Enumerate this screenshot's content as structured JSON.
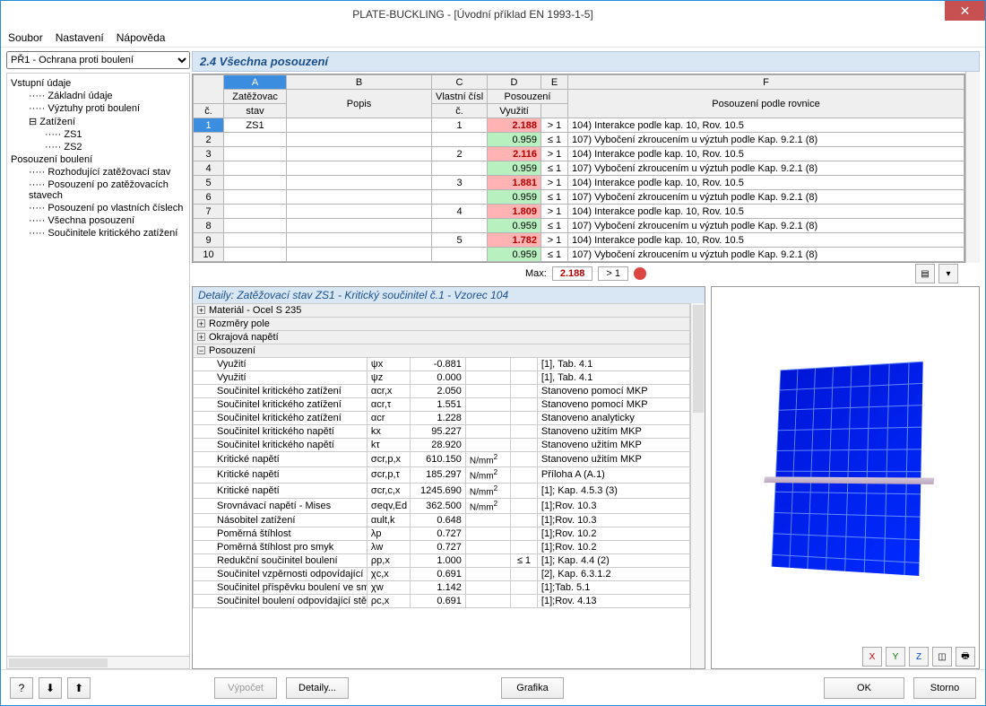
{
  "title": "PLATE-BUCKLING - [Úvodní příklad EN 1993-1-5]",
  "menu": {
    "soubor": "Soubor",
    "nastaveni": "Nastavení",
    "napoveda": "Nápověda"
  },
  "selector": "PŘ1 - Ochrana proti boulení",
  "tree": [
    {
      "lvl": 0,
      "t": "Vstupní údaje"
    },
    {
      "lvl": 1,
      "t": "Základní údaje"
    },
    {
      "lvl": 1,
      "t": "Výztuhy proti boulení"
    },
    {
      "lvl": 1,
      "t": "Zatížení",
      "exp": true
    },
    {
      "lvl": 2,
      "t": "ZS1"
    },
    {
      "lvl": 2,
      "t": "ZS2"
    },
    {
      "lvl": 0,
      "t": "Posouzení boulení"
    },
    {
      "lvl": 1,
      "t": "Rozhodující zatěžovací stav"
    },
    {
      "lvl": 1,
      "t": "Posouzení po zatěžovacích stavech"
    },
    {
      "lvl": 1,
      "t": "Posouzení po vlastních číslech"
    },
    {
      "lvl": 1,
      "t": "Všechna posouzení"
    },
    {
      "lvl": 1,
      "t": "Součinitele kritického zatížení"
    }
  ],
  "section_title": "2.4 Všechna posouzení",
  "grid": {
    "col_letters": [
      "A",
      "B",
      "C",
      "D",
      "E",
      "F"
    ],
    "h_c": "č.",
    "h_zs": "Zatěžovac",
    "h_stav": "stav",
    "h_popis": "Popis",
    "h_vc_top": "Vlastní čísl",
    "h_vc": "č.",
    "h_pos": "Posouzení",
    "h_vyuz": "Využití",
    "h_f": "Posouzení podle rovnice",
    "rows": [
      {
        "n": "1",
        "zs": "ZS1",
        "vc": "1",
        "util": "2.188",
        "cmp": "> 1",
        "red": true,
        "f": "104) Interakce podle kap. 10, Rov. 10.5",
        "sel": true
      },
      {
        "n": "2",
        "zs": "",
        "vc": "",
        "util": "0.959",
        "cmp": "≤ 1",
        "red": false,
        "f": "107) Vybočení zkroucením u výztuh podle Kap. 9.2.1 (8)"
      },
      {
        "n": "3",
        "zs": "",
        "vc": "2",
        "util": "2.116",
        "cmp": "> 1",
        "red": true,
        "f": "104) Interakce podle kap. 10, Rov. 10.5"
      },
      {
        "n": "4",
        "zs": "",
        "vc": "",
        "util": "0.959",
        "cmp": "≤ 1",
        "red": false,
        "f": "107) Vybočení zkroucením u výztuh podle Kap. 9.2.1 (8)"
      },
      {
        "n": "5",
        "zs": "",
        "vc": "3",
        "util": "1.881",
        "cmp": "> 1",
        "red": true,
        "f": "104) Interakce podle kap. 10, Rov. 10.5"
      },
      {
        "n": "6",
        "zs": "",
        "vc": "",
        "util": "0.959",
        "cmp": "≤ 1",
        "red": false,
        "f": "107) Vybočení zkroucením u výztuh podle Kap. 9.2.1 (8)"
      },
      {
        "n": "7",
        "zs": "",
        "vc": "4",
        "util": "1.809",
        "cmp": "> 1",
        "red": true,
        "f": "104) Interakce podle kap. 10, Rov. 10.5"
      },
      {
        "n": "8",
        "zs": "",
        "vc": "",
        "util": "0.959",
        "cmp": "≤ 1",
        "red": false,
        "f": "107) Vybočení zkroucením u výztuh podle Kap. 9.2.1 (8)"
      },
      {
        "n": "9",
        "zs": "",
        "vc": "5",
        "util": "1.782",
        "cmp": "> 1",
        "red": true,
        "f": "104) Interakce podle kap. 10, Rov. 10.5"
      },
      {
        "n": "10",
        "zs": "",
        "vc": "",
        "util": "0.959",
        "cmp": "≤ 1",
        "red": false,
        "f": "107) Vybočení zkroucením u výztuh podle Kap. 9.2.1 (8)"
      }
    ]
  },
  "max": {
    "label": "Max:",
    "val": "2.188",
    "cmp": "> 1"
  },
  "details_title": "Detaily:  Zatěžovací stav ZS1 - Kritický součinitel č.1 - Vzorec 104",
  "det_groups": [
    {
      "exp": "⊞",
      "t": "Materiál - Ocel S 235"
    },
    {
      "exp": "⊞",
      "t": "Rozměry pole"
    },
    {
      "exp": "⊞",
      "t": "Okrajová napětí"
    },
    {
      "exp": "⊟",
      "t": "Posouzení"
    }
  ],
  "det_rows": [
    {
      "l": "Využití",
      "s": "ψx",
      "v": "-0.881",
      "u": "",
      "c": "",
      "n": "[1], Tab. 4.1"
    },
    {
      "l": "Využití",
      "s": "ψz",
      "v": "0.000",
      "u": "",
      "c": "",
      "n": "[1], Tab. 4.1"
    },
    {
      "l": "Součinitel kritického zatížení",
      "s": "αcr,x",
      "v": "2.050",
      "u": "",
      "c": "",
      "n": "Stanoveno pomocí MKP"
    },
    {
      "l": "Součinitel kritického zatížení",
      "s": "αcr,τ",
      "v": "1.551",
      "u": "",
      "c": "",
      "n": "Stanoveno pomocí MKP"
    },
    {
      "l": "Součinitel kritického zatížení",
      "s": "αcr",
      "v": "1.228",
      "u": "",
      "c": "",
      "n": "Stanoveno analyticky"
    },
    {
      "l": "Součinitel kritického napětí",
      "s": "kx",
      "v": "95.227",
      "u": "",
      "c": "",
      "n": "Stanoveno užitím MKP"
    },
    {
      "l": "Součinitel kritického napětí",
      "s": "kτ",
      "v": "28.920",
      "u": "",
      "c": "",
      "n": "Stanoveno užitím MKP"
    },
    {
      "l": "Kritické napětí",
      "s": "σcr,p,x",
      "v": "610.150",
      "u": "N/mm²",
      "c": "",
      "n": "Stanoveno užitím MKP"
    },
    {
      "l": "Kritické napětí",
      "s": "σcr,p,τ",
      "v": "185.297",
      "u": "N/mm²",
      "c": "",
      "n": "Příloha A (A.1)"
    },
    {
      "l": "Kritické napětí",
      "s": "σcr,c,x",
      "v": "1245.690",
      "u": "N/mm²",
      "c": "",
      "n": "[1]; Kap. 4.5.3 (3)"
    },
    {
      "l": "Srovnávací napětí - Mises",
      "s": "σeqv,Ed",
      "v": "362.500",
      "u": "N/mm²",
      "c": "",
      "n": "[1];Rov. 10.3"
    },
    {
      "l": "Násobitel zatížení",
      "s": "αult,k",
      "v": "0.648",
      "u": "",
      "c": "",
      "n": "[1];Rov. 10.3"
    },
    {
      "l": "Poměrná štíhlost",
      "s": "λp",
      "v": "0.727",
      "u": "",
      "c": "",
      "n": "[1];Rov. 10.2"
    },
    {
      "l": "Poměrná štíhlost pro smyk",
      "s": "λw",
      "v": "0.727",
      "u": "",
      "c": "",
      "n": "[1];Rov. 10.2"
    },
    {
      "l": "Redukční součinitel boulení",
      "s": "ρp,x",
      "v": "1.000",
      "u": "",
      "c": "≤ 1",
      "n": "[1]; Kap. 4.4 (2)"
    },
    {
      "l": "Součinitel vzpěrnosti odpovídající prutu",
      "s": "χc,x",
      "v": "0.691",
      "u": "",
      "c": "",
      "n": "[2], Kap. 6.3.1.2"
    },
    {
      "l": "Součinitel příspěvku boulení ve smyku",
      "s": "χw",
      "v": "1.142",
      "u": "",
      "c": "",
      "n": "[1];Tab. 5.1"
    },
    {
      "l": "Součinitel boulení odpovídající stěně",
      "s": "ρc,x",
      "v": "0.691",
      "u": "",
      "c": "",
      "n": "[1];Rov. 4.13"
    }
  ],
  "footer": {
    "vypocet": "Výpočet",
    "detaily": "Detaily...",
    "grafika": "Grafika",
    "ok": "OK",
    "storno": "Storno"
  }
}
